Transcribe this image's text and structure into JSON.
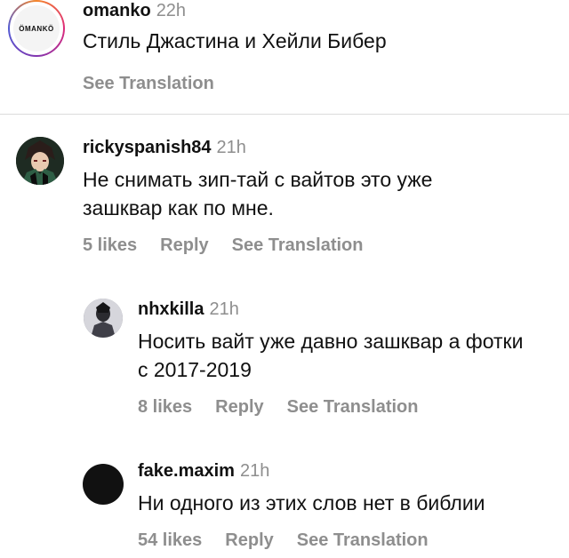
{
  "comments": [
    {
      "username": "omanko",
      "time": "22h",
      "avatar_text": "ÖMANKÖ",
      "text": "Стиль Джастина и Хейли Бибер",
      "actions": {
        "translate": "See Translation"
      }
    },
    {
      "username": "rickyspanish84",
      "time": "21h",
      "text": "Не снимать зип-тай с вайтов это уже зашквар как по мне.",
      "actions": {
        "likes": "5 likes",
        "reply": "Reply",
        "translate": "See Translation"
      }
    },
    {
      "username": "nhxkilla",
      "time": "21h",
      "text": "Носить вайт уже давно зашквар а фотки с 2017-2019",
      "actions": {
        "likes": "8 likes",
        "reply": "Reply",
        "translate": "See Translation"
      }
    },
    {
      "username": "fake.maxim",
      "time": "21h",
      "text": "Ни одного из этих слов нет в библии",
      "actions": {
        "likes": "54 likes",
        "reply": "Reply",
        "translate": "See Translation"
      }
    }
  ]
}
